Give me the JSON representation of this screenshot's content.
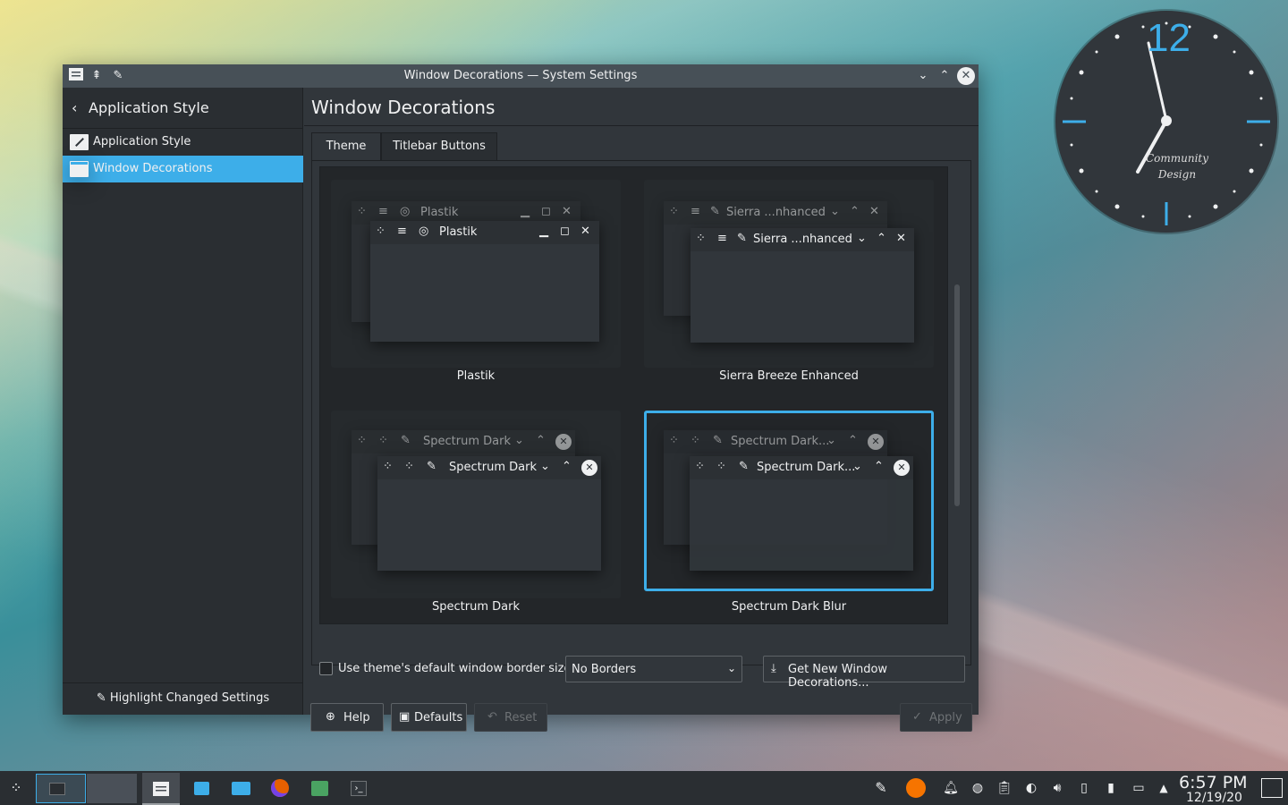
{
  "window": {
    "title": "Window Decorations — System Settings",
    "controls": [
      "chevron-down",
      "chevron-up",
      "close"
    ]
  },
  "sidebar": {
    "back_label": "Application Style",
    "items": [
      {
        "label": "Application Style",
        "selected": false
      },
      {
        "label": "Window Decorations",
        "selected": true
      }
    ],
    "footer_label": "Highlight Changed Settings"
  },
  "main": {
    "title": "Window Decorations",
    "tabs": [
      {
        "label": "Theme",
        "active": true
      },
      {
        "label": "Titlebar Buttons",
        "active": false
      }
    ],
    "themes": [
      {
        "name": "Plastik",
        "preview_back_title": "Plastik",
        "preview_front_title": "Plastik",
        "selected": false
      },
      {
        "name": "Sierra Breeze Enhanced",
        "preview_back_title": "Sierra ...nhanced",
        "preview_front_title": "Sierra ...nhanced",
        "selected": false
      },
      {
        "name": "Spectrum Dark",
        "preview_back_title": "Spectrum Dark",
        "preview_front_title": "Spectrum Dark",
        "selected": false
      },
      {
        "name": "Spectrum Dark Blur",
        "preview_back_title": "Spectrum Dark...",
        "preview_front_title": "Spectrum Dark...",
        "selected": true
      }
    ],
    "border_checkbox_label": "Use theme's default window border size",
    "border_checkbox_checked": false,
    "border_size_value": "No Borders",
    "get_new_label": "Get New Window Decorations...",
    "buttons": {
      "help": "Help",
      "defaults": "Defaults",
      "reset": "Reset",
      "apply": "Apply"
    }
  },
  "desktop_clock": {
    "hour_label": "12",
    "brand_line1": "Community",
    "brand_line2": "Design"
  },
  "taskbar": {
    "time": "6:57 PM",
    "date": "12/19/20"
  },
  "colors": {
    "accent": "#3daee9",
    "window_bg": "#31363b",
    "sidebar_bg": "#2a2e32",
    "text": "#eff0f1"
  }
}
